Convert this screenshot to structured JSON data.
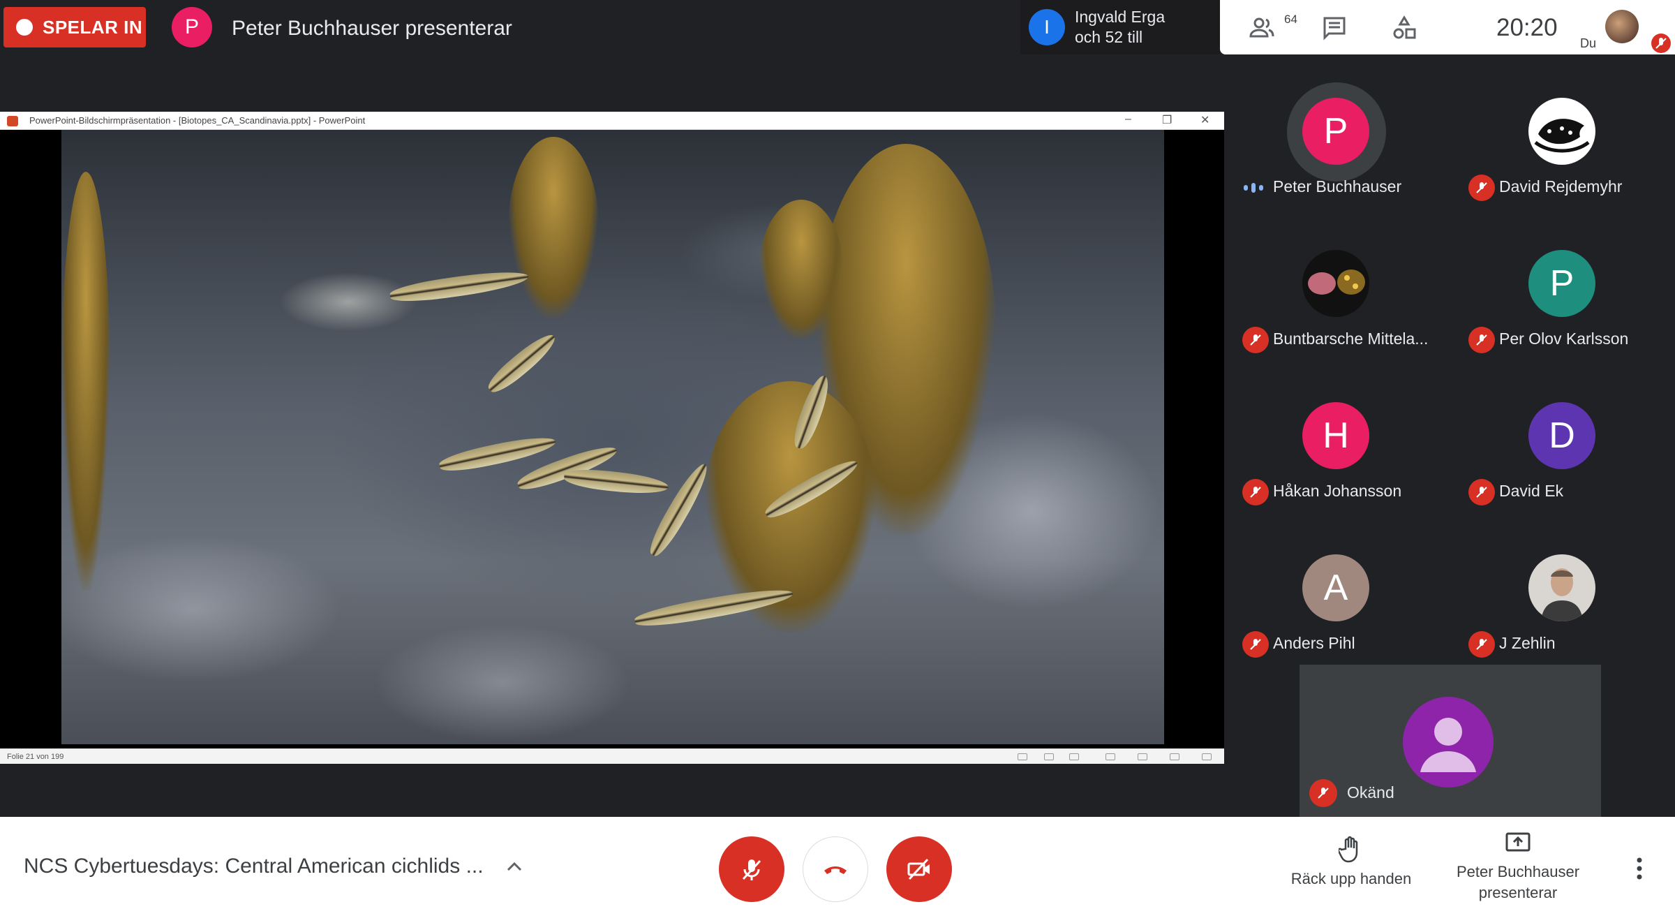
{
  "recording": {
    "label": "SPELAR IN"
  },
  "presenter": {
    "initial": "P",
    "title": "Peter Buchhauser presenterar"
  },
  "join_notice": {
    "initial": "I",
    "line1": "Ingvald Erga",
    "line2": "och 52 till"
  },
  "top_panel": {
    "people_count": "64",
    "clock": "20:20",
    "self_label": "Du"
  },
  "presentation": {
    "window_title": "PowerPoint-Bildschirmpräsentation - [Biotopes_CA_Scandinavia.pptx] - PowerPoint",
    "slide_counter": "Folie 21 von 199"
  },
  "participants": [
    {
      "name": "Peter Buchhauser",
      "initial": "P",
      "color": "#e91e63",
      "speaking": true
    },
    {
      "name": "David Rejdemyhr",
      "initial": "",
      "color": "#ffffff",
      "muted": true,
      "image": "fish-logo"
    },
    {
      "name": "Buntbarsche Mittela...",
      "initial": "",
      "color": "#111111",
      "muted": true,
      "image": "fish-photo"
    },
    {
      "name": "Per Olov Karlsson",
      "initial": "P",
      "color": "#1e8e7e",
      "muted": true
    },
    {
      "name": "Håkan Johansson",
      "initial": "H",
      "color": "#e91e63",
      "muted": true
    },
    {
      "name": "David Ek",
      "initial": "D",
      "color": "#5e35b1",
      "muted": true
    },
    {
      "name": "Anders Pihl",
      "initial": "A",
      "color": "#a1887f",
      "muted": true
    },
    {
      "name": "J Zehlin",
      "initial": "",
      "color": "#d9d6d2",
      "muted": true,
      "image": "portrait"
    }
  ],
  "unknown_participant": {
    "name": "Okänd",
    "color": "#8e24aa"
  },
  "bottom_bar": {
    "meeting_title": "NCS Cybertuesdays: Central American cichlids ...",
    "raise_hand": "Räck upp handen",
    "present_line1": "Peter Buchhauser",
    "present_line2": "presenterar"
  },
  "colors": {
    "accent_red": "#d93025",
    "background": "#202124",
    "tile": "#3c4043"
  }
}
